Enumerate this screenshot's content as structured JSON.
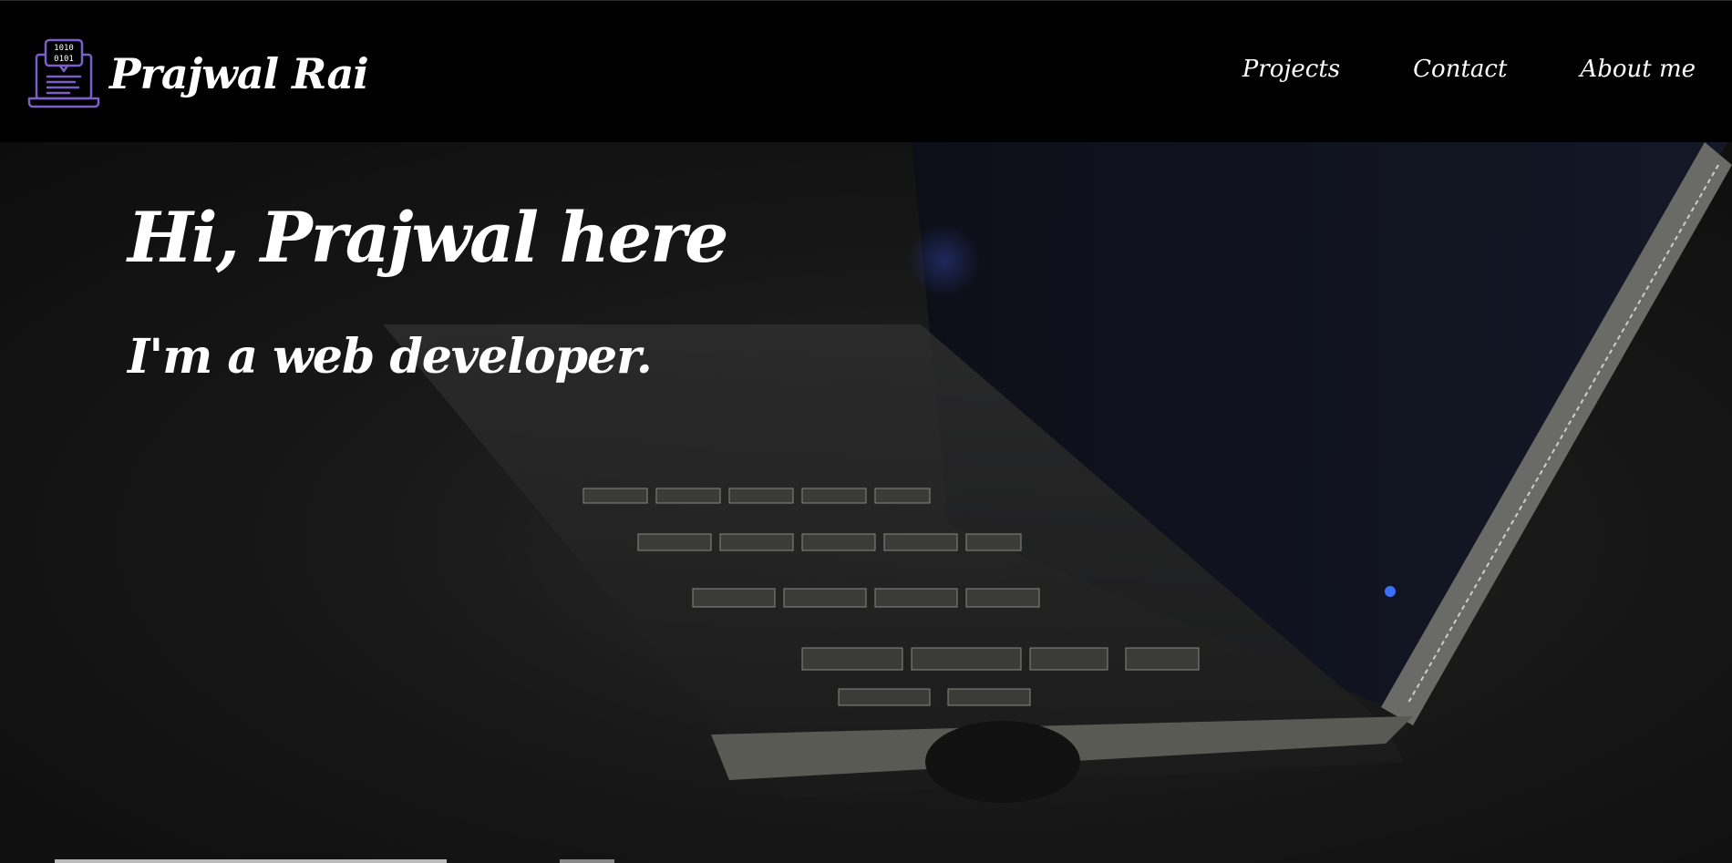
{
  "brand": {
    "name": "Prajwal Rai",
    "logo_icon": "binary-laptop-icon",
    "logo_text_top": "1010",
    "logo_text_bottom": "0101",
    "logo_color": "#7b5fc7"
  },
  "nav": {
    "items": [
      {
        "label": "Projects"
      },
      {
        "label": "Contact"
      },
      {
        "label": "About me"
      }
    ]
  },
  "hero": {
    "title": "Hi, Prajwal here",
    "subtitle": "I'm a web developer.",
    "background_image": "laptop-keyboard-dark-photo"
  }
}
